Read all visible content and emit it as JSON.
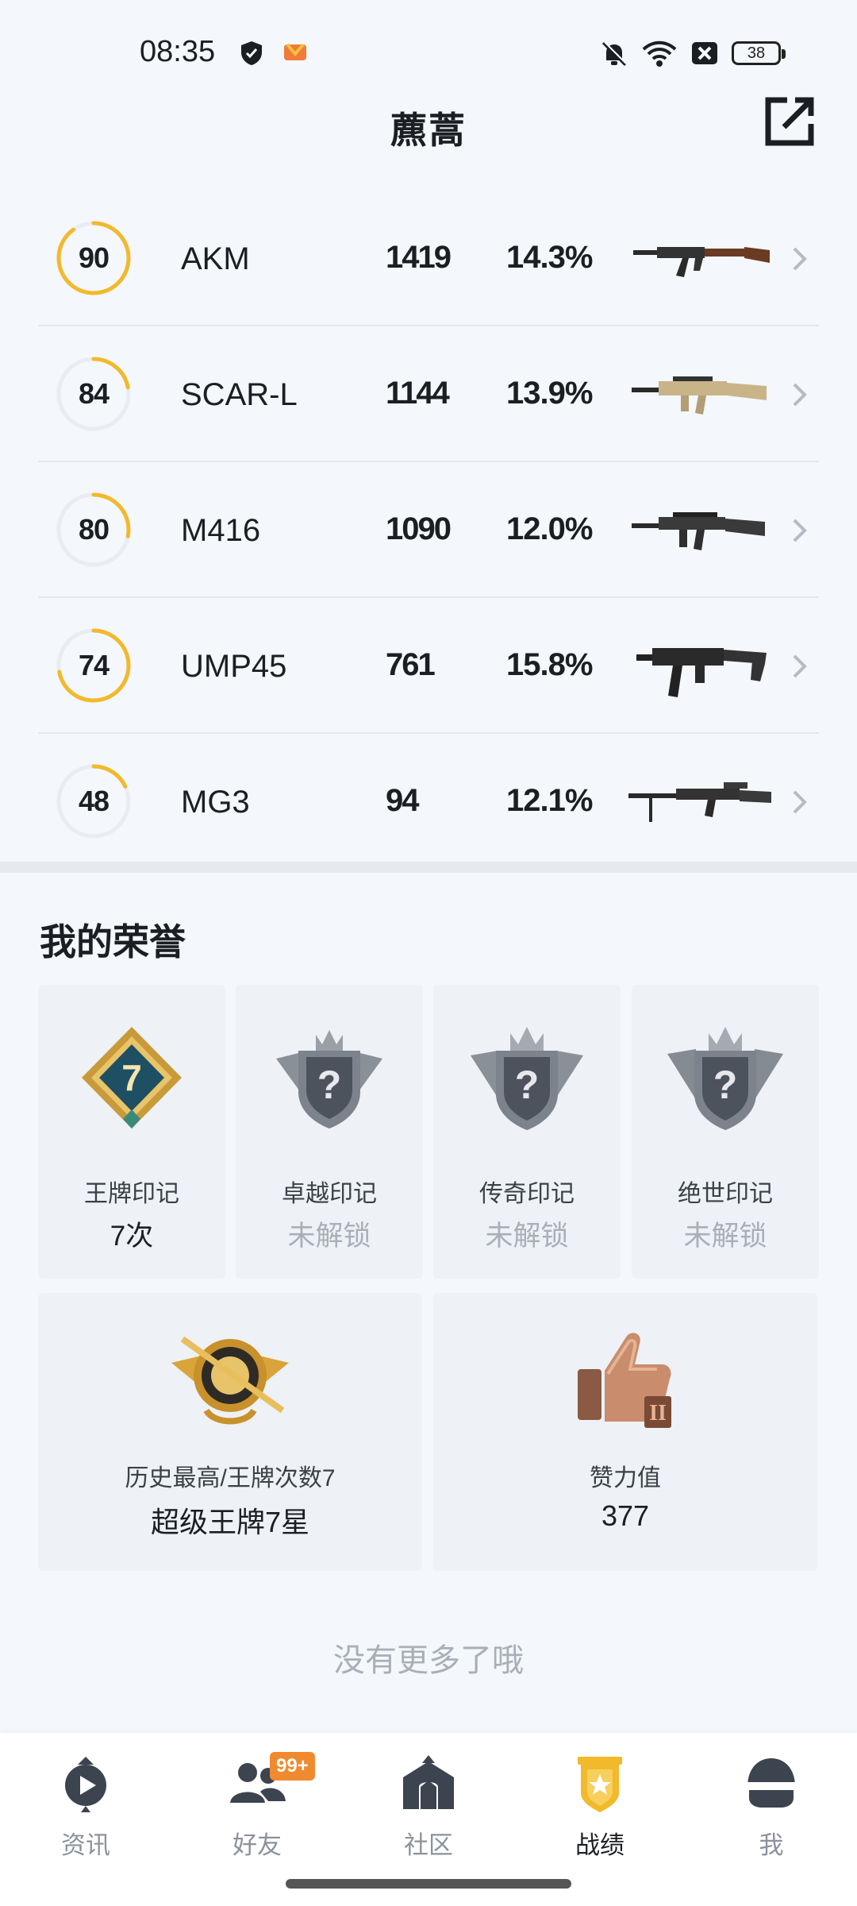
{
  "status_bar": {
    "time": "08:35",
    "battery": "38",
    "icons": [
      "shield-app-icon",
      "game-app-icon",
      "bell-muted-icon",
      "wifi-icon",
      "sim-none-icon",
      "battery-icon"
    ]
  },
  "header": {
    "title": "藨蒿",
    "share_icon": "share-export-icon"
  },
  "weapons": [
    {
      "score": "90",
      "score_fraction": 0.9,
      "name": "AKM",
      "kills": "1419",
      "rate": "14.3%",
      "image": "akm-rifle-image"
    },
    {
      "score": "84",
      "score_fraction": 0.22,
      "name": "SCAR-L",
      "kills": "1144",
      "rate": "13.9%",
      "image": "scar-l-rifle-image"
    },
    {
      "score": "80",
      "score_fraction": 0.28,
      "name": "M416",
      "kills": "1090",
      "rate": "12.0%",
      "image": "m416-rifle-image"
    },
    {
      "score": "74",
      "score_fraction": 0.72,
      "name": "UMP45",
      "kills": "761",
      "rate": "15.8%",
      "image": "ump45-smg-image"
    },
    {
      "score": "48",
      "score_fraction": 0.18,
      "name": "MG3",
      "kills": "94",
      "rate": "12.1%",
      "image": "mg3-lmg-image"
    }
  ],
  "honors": {
    "title": "我的荣誉",
    "badges": [
      {
        "label": "王牌印记",
        "value": "7次",
        "locked": false,
        "icon": "ace-mark-badge"
      },
      {
        "label": "卓越印记",
        "value": "未解锁",
        "locked": true,
        "icon": "locked-crown-badge"
      },
      {
        "label": "传奇印记",
        "value": "未解锁",
        "locked": true,
        "icon": "locked-crown-badge"
      },
      {
        "label": "绝世印记",
        "value": "未解锁",
        "locked": true,
        "icon": "locked-crown-badge"
      }
    ],
    "stats": [
      {
        "label": "历史最高/王牌次数7",
        "value": "超级王牌7星",
        "icon": "super-ace-emblem"
      },
      {
        "label": "赞力值",
        "value": "377",
        "icon": "thumbs-up-trophy"
      }
    ]
  },
  "footer_text": "没有更多了哦",
  "nav": [
    {
      "label": "资讯",
      "icon": "news-play-icon",
      "active": false
    },
    {
      "label": "好友",
      "icon": "friends-icon",
      "active": false,
      "badge": "99+"
    },
    {
      "label": "社区",
      "icon": "community-house-icon",
      "active": false
    },
    {
      "label": "战绩",
      "icon": "record-badge-icon",
      "active": true
    },
    {
      "label": "我",
      "icon": "helmet-profile-icon",
      "active": false
    }
  ],
  "colors": {
    "accent": "#f2b92b",
    "ring_track": "#e9ecf0",
    "badge_orange": "#f08a2e",
    "locked_text": "#a9afb8"
  }
}
